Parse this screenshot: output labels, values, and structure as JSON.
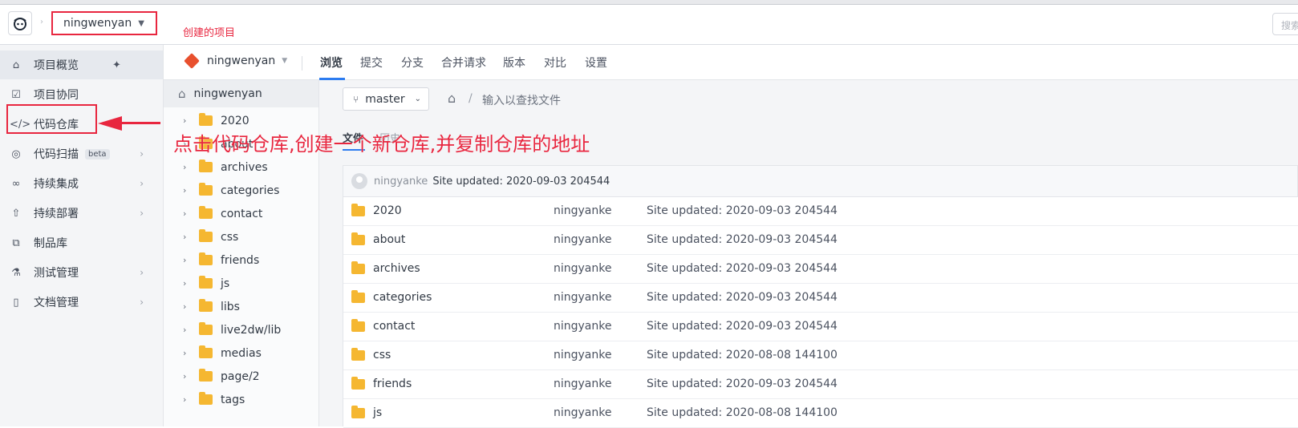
{
  "topbar": {
    "project_name": "ningwenyan",
    "annotation": "创建的项目",
    "search_placeholder": "搜索"
  },
  "sidebar": {
    "items": [
      {
        "label": "项目概览",
        "icon": "home-icon",
        "pinned": true
      },
      {
        "label": "项目协同",
        "icon": "checkbox-icon"
      },
      {
        "label": "代码仓库",
        "icon": "code-icon",
        "active": true
      },
      {
        "label": "代码扫描",
        "icon": "scan-icon",
        "badge": "beta",
        "has_children": true
      },
      {
        "label": "持续集成",
        "icon": "infinity-icon",
        "has_children": true
      },
      {
        "label": "持续部署",
        "icon": "rocket-icon",
        "has_children": true
      },
      {
        "label": "制品库",
        "icon": "package-icon"
      },
      {
        "label": "测试管理",
        "icon": "flask-icon",
        "has_children": true
      },
      {
        "label": "文档管理",
        "icon": "document-icon",
        "has_children": true
      }
    ]
  },
  "repo": {
    "name": "ningwenyan",
    "tabs": [
      "浏览",
      "提交",
      "分支",
      "合并请求",
      "版本",
      "对比",
      "设置"
    ],
    "active_tab": "浏览"
  },
  "tree": {
    "root": "ningwenyan",
    "items": [
      "2020",
      "about",
      "archives",
      "categories",
      "contact",
      "css",
      "friends",
      "js",
      "libs",
      "live2dw/lib",
      "medias",
      "page/2",
      "tags"
    ]
  },
  "browser": {
    "branch": "master",
    "find_placeholder": "输入以查找文件",
    "subtab_files": "文件",
    "subtab_other": "历史",
    "last_commit": {
      "author": "ningyanke",
      "message": "Site updated: 2020-09-03 204544"
    },
    "files": [
      {
        "name": "2020",
        "author": "ningyanke",
        "message": "Site updated: 2020-09-03 204544"
      },
      {
        "name": "about",
        "author": "ningyanke",
        "message": "Site updated: 2020-09-03 204544"
      },
      {
        "name": "archives",
        "author": "ningyanke",
        "message": "Site updated: 2020-09-03 204544"
      },
      {
        "name": "categories",
        "author": "ningyanke",
        "message": "Site updated: 2020-09-03 204544"
      },
      {
        "name": "contact",
        "author": "ningyanke",
        "message": "Site updated: 2020-09-03 204544"
      },
      {
        "name": "css",
        "author": "ningyanke",
        "message": "Site updated: 2020-08-08 144100"
      },
      {
        "name": "friends",
        "author": "ningyanke",
        "message": "Site updated: 2020-09-03 204544"
      },
      {
        "name": "js",
        "author": "ningyanke",
        "message": "Site updated: 2020-08-08 144100"
      }
    ]
  },
  "annotation": {
    "main_text": "点击代码仓库,创建一个新仓库,并复制仓库的地址",
    "color": "#e8263f"
  }
}
